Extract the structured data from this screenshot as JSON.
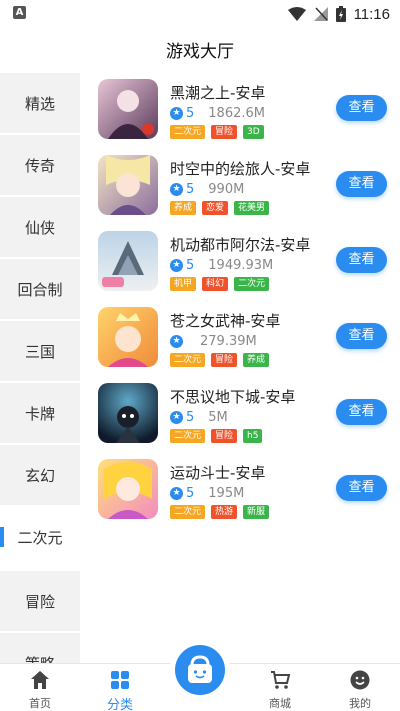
{
  "status_bar": {
    "left_icon": "A",
    "time": "11:16"
  },
  "header": {
    "title": "游戏大厅"
  },
  "sidebar": {
    "active_index": 7,
    "items": [
      {
        "label": "精选"
      },
      {
        "label": "传奇"
      },
      {
        "label": "仙侠"
      },
      {
        "label": "回合制"
      },
      {
        "label": "三国"
      },
      {
        "label": "卡牌"
      },
      {
        "label": "玄幻"
      },
      {
        "label": "二次元"
      },
      {
        "label": "冒险"
      },
      {
        "label": "策略"
      }
    ]
  },
  "games": [
    {
      "title": "黑潮之上-安卓",
      "rating": "5",
      "size": "1862.6M",
      "tags": [
        {
          "label": "二次元",
          "color": "#f5a623"
        },
        {
          "label": "冒险",
          "color": "#f0532b"
        },
        {
          "label": "3D",
          "color": "#3bb54a"
        }
      ],
      "button": "查看"
    },
    {
      "title": "时空中的绘旅人-安卓",
      "rating": "5",
      "size": "990M",
      "tags": [
        {
          "label": "养成",
          "color": "#f5a623"
        },
        {
          "label": "恋爱",
          "color": "#f0532b"
        },
        {
          "label": "花美男",
          "color": "#3bb54a"
        }
      ],
      "button": "查看"
    },
    {
      "title": "机动都市阿尔法-安卓",
      "rating": "5",
      "size": "1949.93M",
      "tags": [
        {
          "label": "机甲",
          "color": "#f5a623"
        },
        {
          "label": "科幻",
          "color": "#f0532b"
        },
        {
          "label": "二次元",
          "color": "#3bb54a"
        }
      ],
      "button": "查看"
    },
    {
      "title": "苍之女武神-安卓",
      "rating": "",
      "size": "279.39M",
      "tags": [
        {
          "label": "二次元",
          "color": "#f5a623"
        },
        {
          "label": "冒险",
          "color": "#f0532b"
        },
        {
          "label": "养成",
          "color": "#3bb54a"
        }
      ],
      "button": "查看"
    },
    {
      "title": "不思议地下城-安卓",
      "rating": "5",
      "size": "5M",
      "tags": [
        {
          "label": "二次元",
          "color": "#f5a623"
        },
        {
          "label": "冒险",
          "color": "#f0532b"
        },
        {
          "label": "h5",
          "color": "#3bb54a"
        }
      ],
      "button": "查看"
    },
    {
      "title": "运动斗士-安卓",
      "rating": "5",
      "size": "195M",
      "tags": [
        {
          "label": "二次元",
          "color": "#f5a623"
        },
        {
          "label": "热游",
          "color": "#f0532b"
        },
        {
          "label": "新服",
          "color": "#3bb54a"
        }
      ],
      "button": "查看"
    }
  ],
  "bottom_nav": {
    "items": [
      {
        "label": "首页",
        "icon": "home-icon"
      },
      {
        "label": "分类",
        "icon": "grid-icon"
      },
      {
        "label": "",
        "icon": "shopping-bag-icon"
      },
      {
        "label": "商城",
        "icon": "cart-icon"
      },
      {
        "label": "我的",
        "icon": "smiley-icon"
      }
    ],
    "active_index": 1
  },
  "colors": {
    "accent": "#2b8cf0",
    "sidebar_bg": "#f2f2f2"
  }
}
